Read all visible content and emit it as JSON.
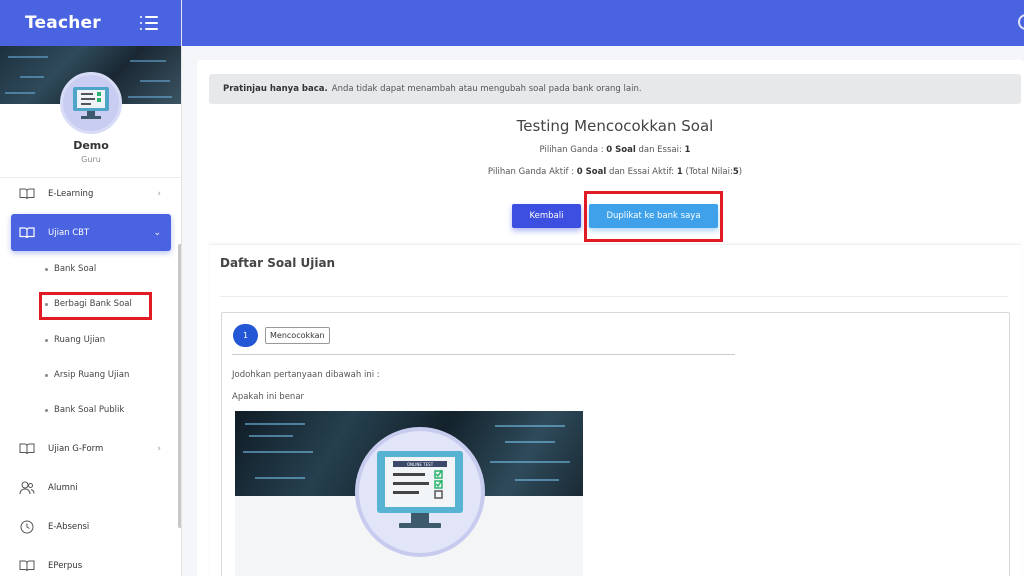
{
  "app": {
    "brand": "Teacher",
    "accent": "#4a63e0",
    "highlight_color": "#e01b24"
  },
  "user": {
    "name": "Demo",
    "role": "Guru"
  },
  "sidebar": {
    "items": [
      {
        "label": "E-Learning",
        "icon": "book-icon",
        "has_chevron": true
      },
      {
        "label": "Ujian CBT",
        "icon": "book-open-icon",
        "active": true,
        "expanded": true
      },
      {
        "label": "Ujian G-Form",
        "icon": "book-icon",
        "has_chevron": true
      },
      {
        "label": "Alumni",
        "icon": "users-icon"
      },
      {
        "label": "E-Absensi",
        "icon": "clock-icon"
      },
      {
        "label": "EPerpus",
        "icon": "book-icon"
      }
    ],
    "sub_items": [
      {
        "label": "Bank Soal"
      },
      {
        "label": "Berbagi Bank Soal",
        "highlighted": true
      },
      {
        "label": "Ruang Ujian"
      },
      {
        "label": "Arsip Ruang Ujian"
      },
      {
        "label": "Bank Soal Publik"
      }
    ]
  },
  "notice": {
    "bold": "Pratinjau hanya baca.",
    "text": "Anda tidak dapat menambah atau mengubah soal pada bank orang lain."
  },
  "header": {
    "title": "Testing Mencocokkan Soal",
    "line1": {
      "p1": "Pilihan Ganda :",
      "v1": "0 Soal",
      "p2": "dan Essai:",
      "v2": "1"
    },
    "line2": {
      "p1": "Pilihan Ganda Aktif :",
      "v1": "0 Soal",
      "p2": "dan Essai Aktif:",
      "v2": "1",
      "p3": "(Total Nilai:",
      "v3": "5",
      "p4": ")"
    }
  },
  "buttons": {
    "back": "Kembali",
    "duplicate": "Duplikat ke bank saya"
  },
  "question_list": {
    "title": "Daftar Soal Ujian",
    "questions": [
      {
        "number": "1",
        "type": "Mencocokkan",
        "instruction": "Jodohkan pertanyaan dibawah ini :",
        "text": "Apakah ini benar",
        "image_caption": "ONLINE TEST"
      }
    ]
  }
}
